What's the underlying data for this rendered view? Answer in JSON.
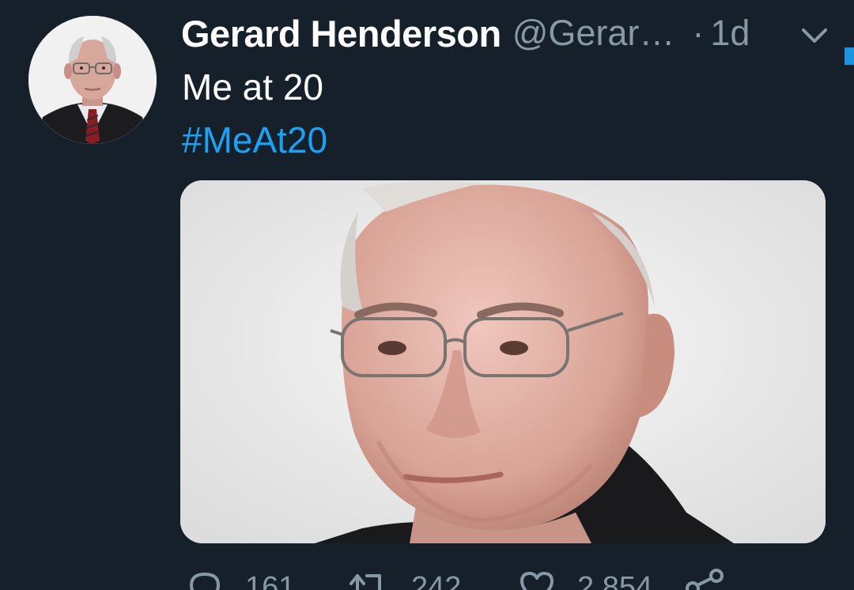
{
  "tweet": {
    "author_name": "Gerard Henderson",
    "author_handle": "@Gerar…",
    "separator": "·",
    "timestamp": "1d",
    "text": "Me at 20",
    "hashtag": "#MeAt20"
  },
  "actions": {
    "reply_count": "161",
    "retweet_count": "242",
    "like_count": "2,854"
  },
  "icons": {
    "reply": "reply-icon",
    "retweet": "retweet-icon",
    "like": "heart-icon",
    "share": "share-icon",
    "menu": "chevron-down-icon"
  },
  "colors": {
    "background": "#15202b",
    "secondary_text": "#8899a6",
    "link": "#1da1f2"
  }
}
